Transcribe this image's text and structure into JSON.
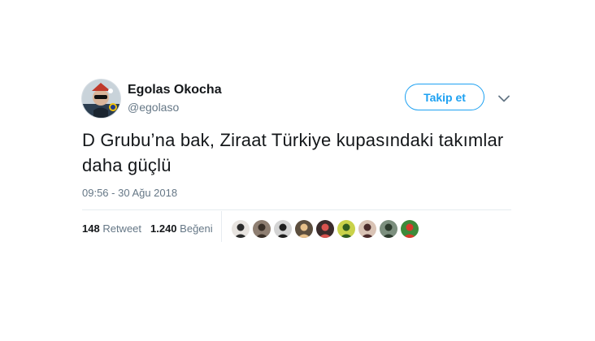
{
  "author": {
    "display_name": "Egolas Okocha",
    "handle": "@egolaso",
    "avatar_icon": "profile-photo-avatar"
  },
  "follow_button": {
    "label": "Takip et"
  },
  "menu": {
    "icon": "chevron-down-icon"
  },
  "tweet": {
    "text": "D Grubu’na bak, Ziraat Türkiye kupasındaki takımlar daha güçlü",
    "timestamp": "09:56 - 30 Ağu 2018"
  },
  "stats": {
    "retweet_count": "148",
    "retweet_label": "Retweet",
    "like_count": "1.240",
    "like_label": "Beğeni"
  },
  "likers": [
    {
      "icon": "user-avatar",
      "bg": "#e8e4e0",
      "fg": "#2b2b2b"
    },
    {
      "icon": "user-avatar",
      "bg": "#8f7f72",
      "fg": "#3a3028"
    },
    {
      "icon": "user-avatar",
      "bg": "#d4d4d4",
      "fg": "#1f1f1f"
    },
    {
      "icon": "user-avatar",
      "bg": "#5c4e3e",
      "fg": "#e7c08a"
    },
    {
      "icon": "user-avatar",
      "bg": "#3a2b2b",
      "fg": "#d9534f"
    },
    {
      "icon": "user-avatar",
      "bg": "#c9d24a",
      "fg": "#2f5d1f"
    },
    {
      "icon": "user-avatar",
      "bg": "#d9c3b5",
      "fg": "#4a2a2a"
    },
    {
      "icon": "user-avatar",
      "bg": "#7c8f7e",
      "fg": "#2b3a2c"
    },
    {
      "icon": "user-avatar",
      "bg": "#3e8a3a",
      "fg": "#d93a2b"
    }
  ]
}
